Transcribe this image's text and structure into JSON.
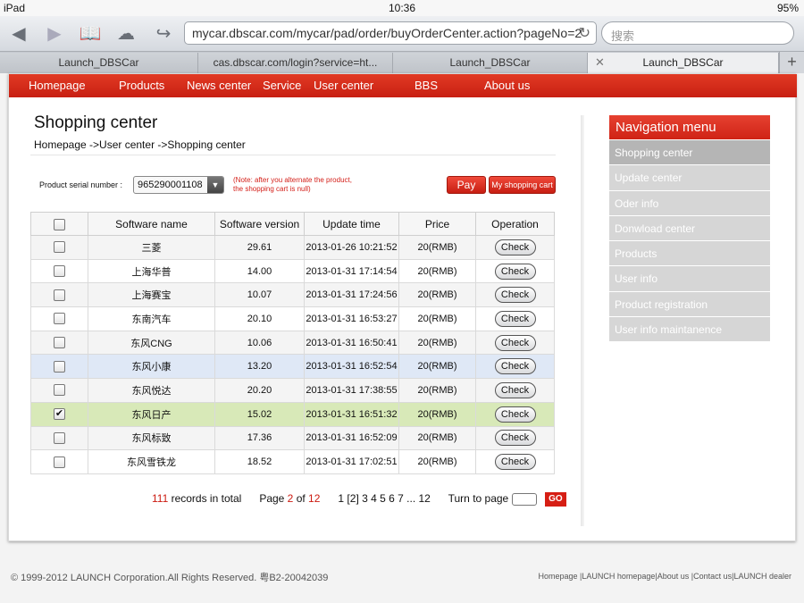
{
  "status_bar": {
    "device": "iPad",
    "time": "10:36",
    "battery": "95%"
  },
  "browser": {
    "url": "mycar.dbscar.com/mycar/pad/order/buyOrderCenter.action?pageNo=2",
    "search_placeholder": "搜索",
    "tabs": [
      "Launch_DBSCar",
      "cas.dbscar.com/login?service=ht...",
      "Launch_DBSCar",
      "Launch_DBSCar"
    ]
  },
  "nav": {
    "items": [
      "Homepage",
      "Products",
      "News center",
      "Service",
      "User center",
      "BBS",
      "About us"
    ]
  },
  "page": {
    "title": "Shopping center",
    "breadcrumb": "Homepage ->User center ->Shopping center",
    "serial_label": "Product serial number :",
    "serial_value": "965290001108",
    "note_line1": "(Note: after you alternate the product,",
    "note_line2": "the shopping cart is null)",
    "pay_label": "Pay",
    "cart_label": "My shopping cart"
  },
  "table": {
    "headers": [
      "Software name",
      "Software version",
      "Update time",
      "Price",
      "Operation"
    ],
    "check_label": "Check",
    "rows": [
      {
        "name": "三菱",
        "version": "29.61",
        "time": "2013-01-26 10:21:52",
        "price": "20(RMB)",
        "checked": false
      },
      {
        "name": "上海华普",
        "version": "14.00",
        "time": "2013-01-31 17:14:54",
        "price": "20(RMB)",
        "checked": false
      },
      {
        "name": "上海赛宝",
        "version": "10.07",
        "time": "2013-01-31 17:24:56",
        "price": "20(RMB)",
        "checked": false
      },
      {
        "name": "东南汽车",
        "version": "20.10",
        "time": "2013-01-31 16:53:27",
        "price": "20(RMB)",
        "checked": false
      },
      {
        "name": "东风CNG",
        "version": "10.06",
        "time": "2013-01-31 16:50:41",
        "price": "20(RMB)",
        "checked": false
      },
      {
        "name": "东风小康",
        "version": "13.20",
        "time": "2013-01-31 16:52:54",
        "price": "20(RMB)",
        "checked": false
      },
      {
        "name": "东风悦达",
        "version": "20.20",
        "time": "2013-01-31 17:38:55",
        "price": "20(RMB)",
        "checked": false
      },
      {
        "name": "东风日产",
        "version": "15.02",
        "time": "2013-01-31 16:51:32",
        "price": "20(RMB)",
        "checked": true
      },
      {
        "name": "东风标致",
        "version": "17.36",
        "time": "2013-01-31 16:52:09",
        "price": "20(RMB)",
        "checked": false
      },
      {
        "name": "东风雪铁龙",
        "version": "18.52",
        "time": "2013-01-31 17:02:51",
        "price": "20(RMB)",
        "checked": false
      }
    ]
  },
  "pager": {
    "total": "111",
    "total_suffix": " records in total",
    "page_prefix": "Page ",
    "current": "2",
    "of": " of ",
    "pages": "12",
    "links": "1 [2] 3 4 5 6 7 ... 12",
    "turn_to": "Turn to page",
    "go": "GO"
  },
  "side_menu": {
    "title": "Navigation menu",
    "items": [
      "Shopping center",
      "Update center",
      "Oder info",
      "Donwload center",
      "Products",
      "User info",
      "Product registration",
      "User info maintanence"
    ]
  },
  "footer": {
    "copyright": "© 1999-2012 LAUNCH Corporation.All Rights Reserved. 粤B2-20042039",
    "links": [
      "Homepage",
      "LAUNCH homepage",
      "About us",
      "Contact us",
      "LAUNCH dealer"
    ]
  }
}
